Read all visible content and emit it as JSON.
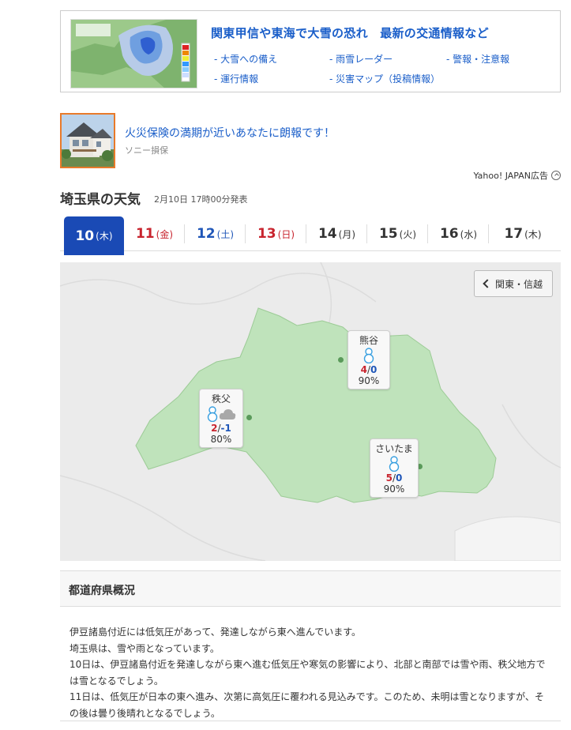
{
  "banner": {
    "title": "関東甲信や東海で大雪の恐れ　最新の交通情報など",
    "links": [
      "- 大雪への備え",
      "- 雨雪レーダー",
      "- 警報・注意報",
      "- 運行情報",
      "- 災害マップ（投稿情報）"
    ]
  },
  "ad": {
    "title": "火災保険の満期が近いあなたに朗報です！",
    "sponsor": "ソニー損保",
    "label": "Yahoo! JAPAN広告"
  },
  "weather": {
    "title": "埼玉県の天気",
    "published": "2月10日 17時00分発表",
    "tabs": [
      {
        "num": "10",
        "dow": "(木)",
        "color": "active"
      },
      {
        "num": "11",
        "dow": "(金)",
        "color": "red"
      },
      {
        "num": "12",
        "dow": "(土)",
        "color": "blue"
      },
      {
        "num": "13",
        "dow": "(日)",
        "color": "red"
      },
      {
        "num": "14",
        "dow": "(月)",
        "color": "black"
      },
      {
        "num": "15",
        "dow": "(火)",
        "color": "black"
      },
      {
        "num": "16",
        "dow": "(水)",
        "color": "black"
      },
      {
        "num": "17",
        "dow": "(木)",
        "color": "black"
      }
    ],
    "region_button": "関東・信越",
    "cities": {
      "kumagaya": {
        "name": "熊谷",
        "max": "4",
        "min": "0",
        "pop": "90%",
        "icons": [
          "snow-icon"
        ]
      },
      "chichibu": {
        "name": "秩父",
        "max": "2",
        "min": "-1",
        "pop": "80%",
        "icons": [
          "snow-icon",
          "cloud-icon"
        ]
      },
      "saitama": {
        "name": "さいたま",
        "max": "5",
        "min": "0",
        "pop": "90%",
        "icons": [
          "snow-icon"
        ]
      }
    }
  },
  "overview": {
    "title": "都道府県概況",
    "lines": [
      "伊豆諸島付近には低気圧があって、発達しながら東へ進んでいます。",
      "埼玉県は、雪や雨となっています。",
      "10日は、伊豆諸島付近を発達しながら東へ進む低気圧や寒気の影響により、北部と南部では雪や雨、秩父地方では雪となるでしょう。",
      "11日は、低気圧が日本の東へ進み、次第に高気圧に覆われる見込みです。このため、未明は雪となりますが、その後は曇り後晴れとなるでしょう。"
    ]
  },
  "colors": {
    "link": "#1a5ec9",
    "active_tab": "#1a4ab5",
    "red": "#c8242e",
    "blue": "#1f56b8",
    "land": "#bfe3bb"
  }
}
